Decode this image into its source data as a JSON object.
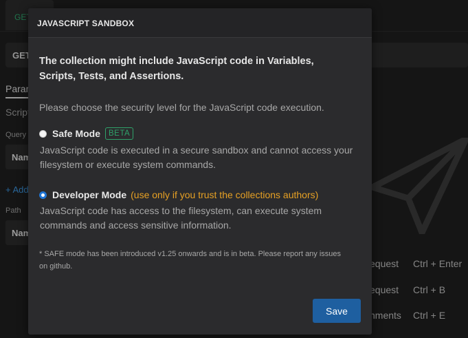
{
  "background": {
    "tab_label": "GET",
    "url_method": "GET",
    "tab_params": "Params",
    "tab_script": "Script",
    "query_label": "Query",
    "name_cell_1": "Name",
    "add_param": "+ Add",
    "path_label": "Path",
    "name_cell_2": "Name",
    "shortcuts": [
      {
        "action": "equest",
        "keys": "Ctrl + Enter"
      },
      {
        "action": "equest",
        "keys": "Ctrl + B"
      },
      {
        "action": "nments",
        "keys": "Ctrl + E"
      }
    ],
    "plane_icon": "send-plane-icon"
  },
  "modal": {
    "title": "JAVASCRIPT SANDBOX",
    "intro": "The collection might include JavaScript code in Variables, Scripts, Tests, and Assertions.",
    "choose_prompt": "Please choose the security level for the JavaScript code execution.",
    "safe_mode": {
      "label": "Safe Mode",
      "badge": "BETA",
      "description": "JavaScript code is executed in a secure sandbox and cannot access your filesystem or execute system commands.",
      "selected": false
    },
    "developer_mode": {
      "label": "Developer Mode",
      "warning": "(use only if you trust the collections authors)",
      "description": "JavaScript code has access to the filesystem, can execute system commands and access sensitive information.",
      "selected": true
    },
    "note": "* SAFE mode has been introduced v1.25 onwards and is in beta. Please report any issues on github.",
    "save_label": "Save"
  },
  "colors": {
    "accent_green": "#2fa36b",
    "warning_orange": "#e7a124",
    "primary_button": "#1e5fa0",
    "radio_selected": "#1f74d3"
  }
}
